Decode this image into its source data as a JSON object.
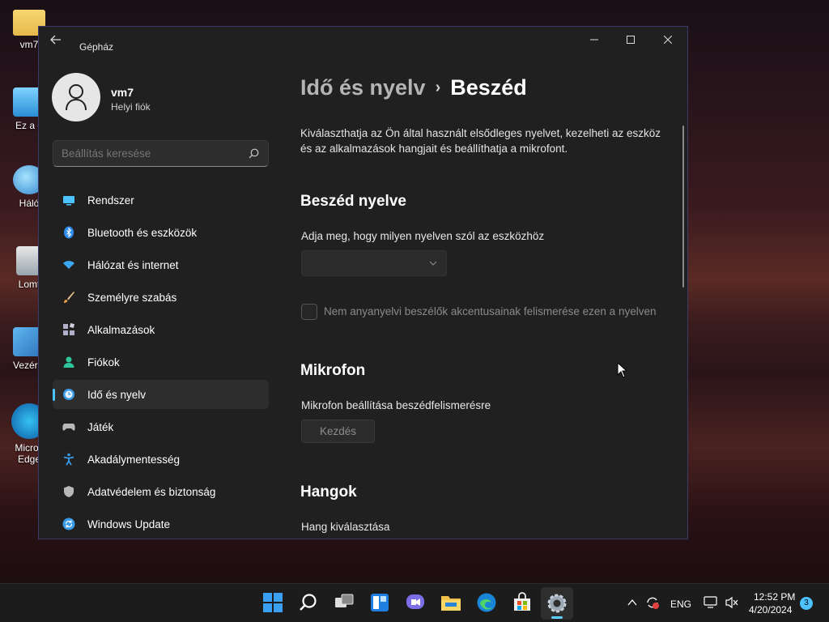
{
  "desktop": {
    "icons": [
      {
        "label": "vm7",
        "icon": "folder-icon"
      },
      {
        "label": "Ez a g",
        "icon": "this-pc-icon"
      },
      {
        "label": "Háló",
        "icon": "network-icon"
      },
      {
        "label": "Lomt",
        "icon": "recycle-bin-icon"
      },
      {
        "label": "Vezérlő",
        "icon": "control-panel-icon"
      },
      {
        "label": "Micros Edge",
        "icon": "edge-icon"
      }
    ]
  },
  "window": {
    "title": "Gépház",
    "controls": {
      "minimize": "—",
      "maximize": "☐",
      "close": "✕"
    }
  },
  "account": {
    "name": "vm7",
    "type": "Helyi fiók"
  },
  "search": {
    "placeholder": "Beállítás keresése"
  },
  "sidebar": {
    "items": [
      {
        "label": "Rendszer",
        "icon": "system-icon",
        "color": "#4cc2ff"
      },
      {
        "label": "Bluetooth és eszközök",
        "icon": "bluetooth-icon",
        "color": "#2f8cf0"
      },
      {
        "label": "Hálózat és internet",
        "icon": "wifi-icon",
        "color": "#3aa7f0"
      },
      {
        "label": "Személyre szabás",
        "icon": "brush-icon",
        "color": "#e6a14a"
      },
      {
        "label": "Alkalmazások",
        "icon": "apps-icon",
        "color": "#b0b0c8"
      },
      {
        "label": "Fiókok",
        "icon": "account-icon",
        "color": "#2ec79b"
      },
      {
        "label": "Idő és nyelv",
        "icon": "time-language-icon",
        "color": "#3a9be8",
        "active": true
      },
      {
        "label": "Játék",
        "icon": "gaming-icon",
        "color": "#b8b8b8"
      },
      {
        "label": "Akadálymentesség",
        "icon": "accessibility-icon",
        "color": "#3a9be8"
      },
      {
        "label": "Adatvédelem és biztonság",
        "icon": "shield-icon",
        "color": "#b8b8b8"
      },
      {
        "label": "Windows Update",
        "icon": "update-icon",
        "color": "#3a9be8"
      }
    ]
  },
  "breadcrumb": {
    "parent": "Idő és nyelv",
    "separator": "›",
    "current": "Beszéd"
  },
  "content": {
    "intro": "Kiválaszthatja az Ön által használt elsődleges nyelvet, kezelheti az eszköz és az alkalmazások hangjait és beállíthatja a mikrofont.",
    "speech_language": {
      "title": "Beszéd nyelve",
      "label": "Adja meg, hogy milyen nyelven szól az eszközhöz",
      "dropdown_value": "",
      "checkbox_label": "Nem anyanyelvi beszélők akcentusainak felismerése ezen a nyelven",
      "checkbox_checked": false
    },
    "microphone": {
      "title": "Mikrofon",
      "label": "Mikrofon beállítása beszédfelismerésre",
      "button": "Kezdés"
    },
    "voices": {
      "title": "Hangok",
      "label": "Hang kiválasztása"
    }
  },
  "taskbar": {
    "apps": [
      "start-icon",
      "search-icon",
      "task-view-icon",
      "widgets-icon",
      "chat-icon",
      "file-explorer-icon",
      "edge-icon",
      "store-icon",
      "settings-icon"
    ],
    "tray": {
      "language": "ENG",
      "time": "12:52 PM",
      "date": "4/20/2024",
      "notifications": "3"
    }
  }
}
